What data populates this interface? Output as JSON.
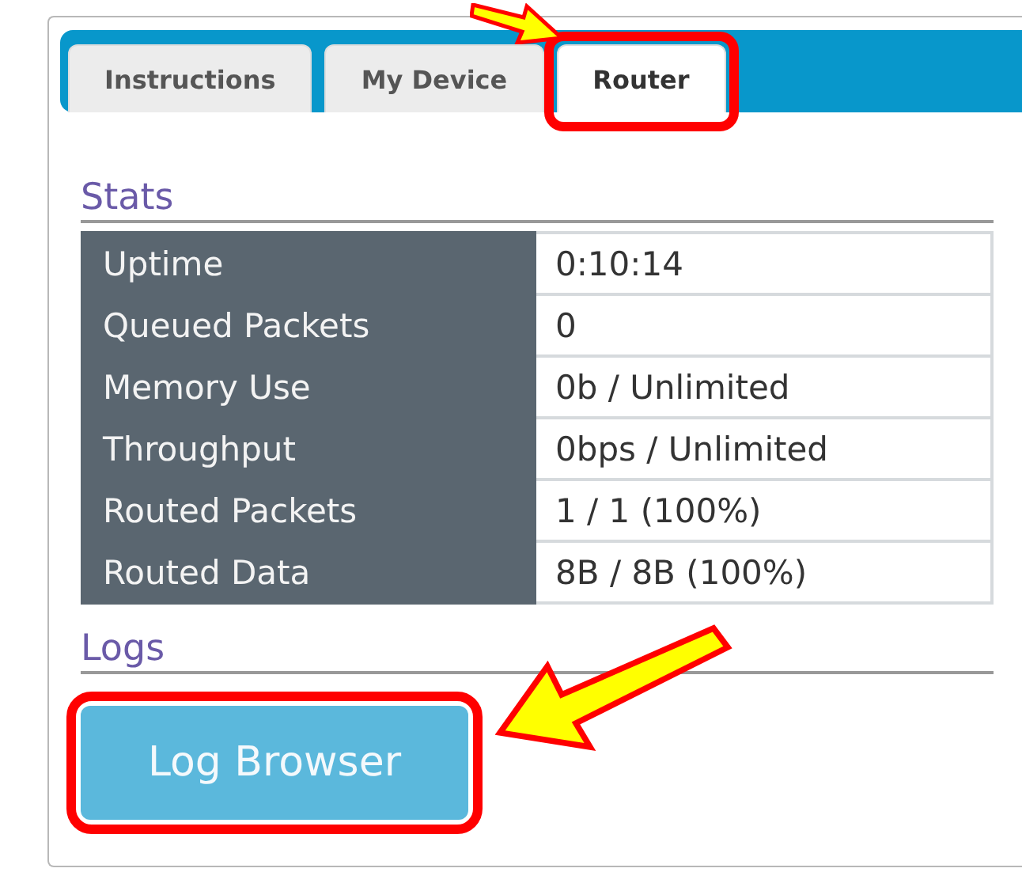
{
  "tabs": [
    {
      "label": "Instructions",
      "selected": false,
      "highlighted": false
    },
    {
      "label": "My Device",
      "selected": false,
      "highlighted": false
    },
    {
      "label": "Router",
      "selected": true,
      "highlighted": true
    }
  ],
  "stats": {
    "heading": "Stats",
    "rows": [
      {
        "label": "Uptime",
        "value": "0:10:14"
      },
      {
        "label": "Queued Packets",
        "value": "0"
      },
      {
        "label": "Memory Use",
        "value": "0b / Unlimited"
      },
      {
        "label": "Throughput",
        "value": "0bps / Unlimited"
      },
      {
        "label": "Routed Packets",
        "value": "1 / 1 (100%)"
      },
      {
        "label": "Routed Data",
        "value": "8B / 8B (100%)"
      }
    ]
  },
  "logs": {
    "heading": "Logs",
    "button": {
      "label": "Log Browser",
      "highlighted": true
    }
  }
}
